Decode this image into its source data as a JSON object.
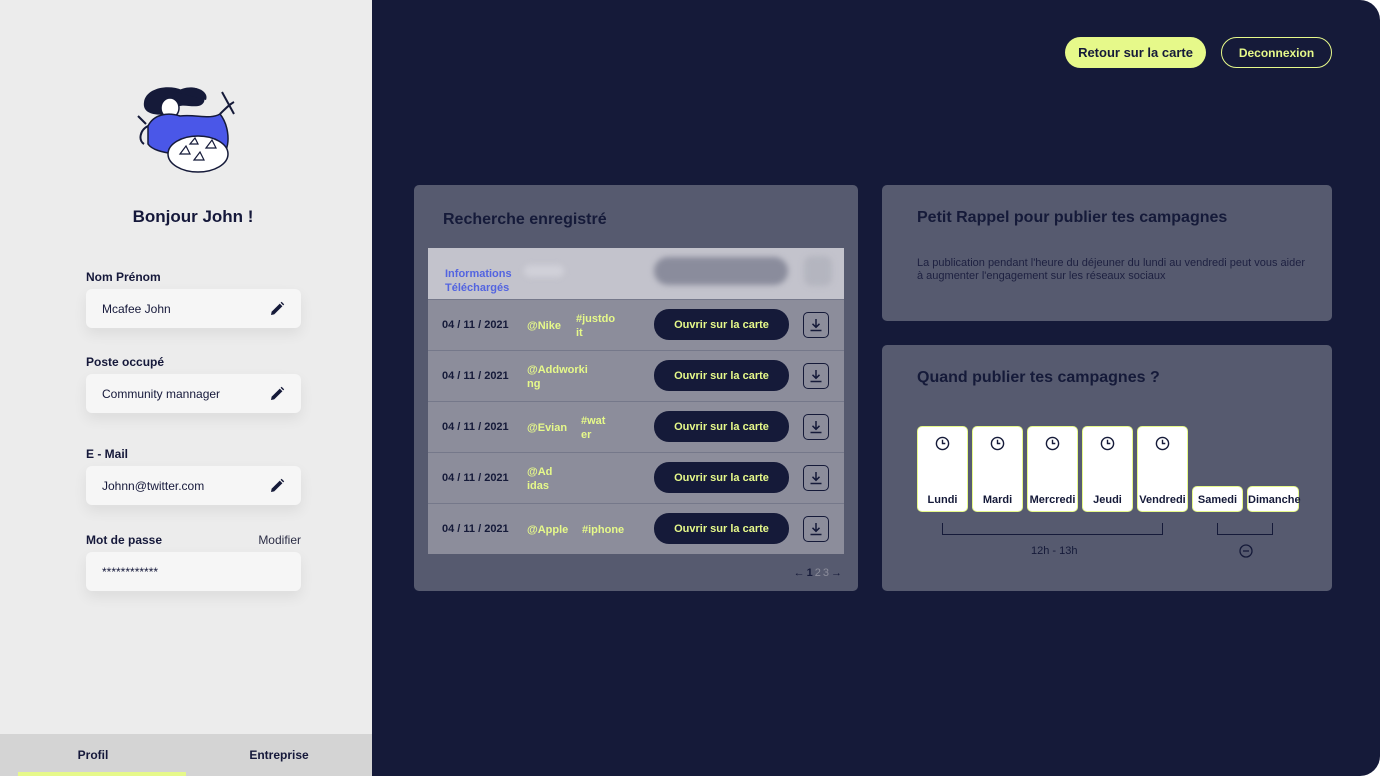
{
  "sidebar": {
    "greeting": "Bonjour John !",
    "fields": [
      {
        "label": "Nom Prénom",
        "value": "Mcafee John"
      },
      {
        "label": "Poste occupé",
        "value": "Community mannager"
      },
      {
        "label": "E - Mail",
        "value": "Johnn@twitter.com"
      },
      {
        "label": "Mot de passe",
        "value": "************",
        "link": "Modifier"
      }
    ],
    "tabs": [
      {
        "label": "Profil",
        "active": true
      },
      {
        "label": "Entreprise",
        "active": false
      }
    ]
  },
  "header": {
    "primary_button": "Retour sur la carte",
    "secondary_button": "Deconnexion"
  },
  "searches": {
    "title": "Recherche enregistré",
    "head_label": "Informations Téléchargés",
    "open_label": "Ouvrir sur la carte",
    "rows": [
      {
        "date": "04 / 11 / 2021",
        "account": "@Nike",
        "hashtag": "#justdoit"
      },
      {
        "date": "04 / 11 / 2021",
        "account": "@Addworking",
        "hashtag": ""
      },
      {
        "date": "04 / 11 / 2021",
        "account": "@Evian",
        "hashtag": "#water"
      },
      {
        "date": "04 / 11 / 2021",
        "account": "@Adidas",
        "hashtag": ""
      },
      {
        "date": "04 / 11 / 2021",
        "account": "@Apple",
        "hashtag": "#iphone"
      }
    ],
    "pagination": {
      "prev": "←",
      "pages": [
        "1",
        "2",
        "3"
      ],
      "current": "1",
      "next": "→"
    }
  },
  "reminder": {
    "title": "Petit Rappel pour publier tes campagnes",
    "text": "La publication pendant l'heure du déjeuner du lundi au vendredi peut vous aider à augmenter l'engagement sur les réseaux sociaux"
  },
  "schedule": {
    "title": "Quand publier tes campagnes ?",
    "weekdays": [
      "Lundi",
      "Mardi",
      "Mercredi",
      "Jeudi",
      "Vendredi"
    ],
    "weekend": [
      "Samedi",
      "Dimanche"
    ],
    "weekday_range": "12h - 13h"
  },
  "colors": {
    "accent": "#e6f98a",
    "dark_bg": "#151a39",
    "card_bg": "#565a6f",
    "link_blue": "#5364e0"
  }
}
